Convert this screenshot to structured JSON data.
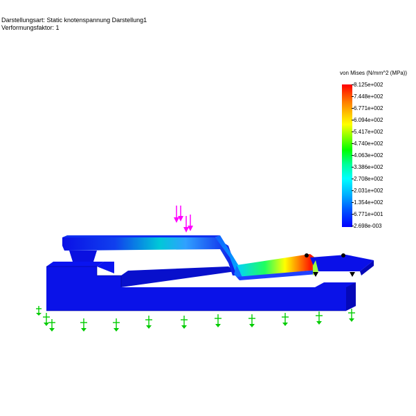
{
  "header": {
    "line1": "Darstellungsart: Static knotenspannung Darstellung1",
    "line2": "Verformungsfaktor: 1"
  },
  "legend": {
    "title": "von Mises (N/mm^2 (MPa))",
    "labels": [
      "8.125e+002",
      "7.448e+002",
      "6.771e+002",
      "6.094e+002",
      "5.417e+002",
      "4.740e+002",
      "4.063e+002",
      "3.386e+002",
      "2.708e+002",
      "2.031e+002",
      "1.354e+002",
      "6.771e+001",
      "2.698e-003"
    ],
    "colors": [
      "#ff0000",
      "#ff7a00",
      "#ffff00",
      "#00ff00",
      "#00ffff",
      "#0000ff"
    ]
  },
  "colors": {
    "model_base": "#0a10e6",
    "model_dark": "#0508b0",
    "load_arrow": "#ff00ff",
    "fixture": "#00cc00"
  }
}
